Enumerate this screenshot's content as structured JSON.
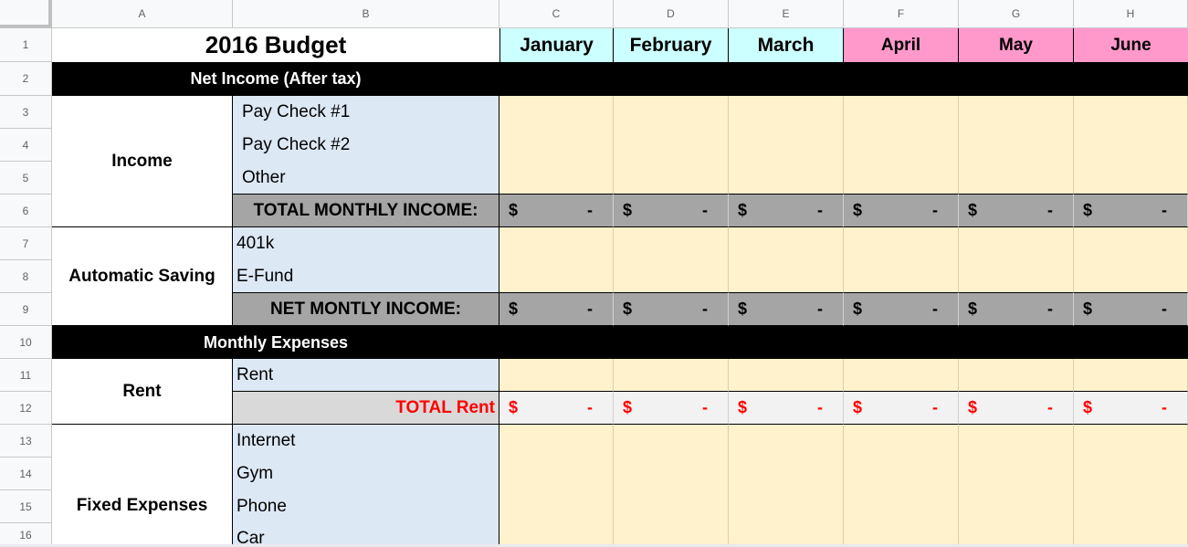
{
  "sheet": {
    "column_headers": [
      "A",
      "B",
      "C",
      "D",
      "E",
      "F",
      "G",
      "H"
    ],
    "row_headers": [
      "1",
      "2",
      "3",
      "4",
      "5",
      "6",
      "7",
      "8",
      "9",
      "10",
      "11",
      "12",
      "13",
      "14",
      "15",
      "16"
    ]
  },
  "budget": {
    "title": "2016 Budget",
    "months": [
      "January",
      "February",
      "March",
      "April",
      "May",
      "June"
    ],
    "colors": {
      "q1_month_bg": "#ccffff",
      "q2_month_bg": "#ff99cc",
      "input_bg": "#fff2cc",
      "label_bg": "#dde8f5",
      "total_bg": "#a5a5a5",
      "rent_total_text": "#ff0000"
    },
    "net_income_section": {
      "header": "Net Income (After tax)",
      "income": {
        "group": "Income",
        "items": [
          "Pay Check #1",
          "Pay Check #2",
          "Other"
        ],
        "total_label": "TOTAL MONTHLY INCOME:",
        "totals": [
          {
            "currency": "$",
            "value": "-"
          },
          {
            "currency": "$",
            "value": "-"
          },
          {
            "currency": "$",
            "value": "-"
          },
          {
            "currency": "$",
            "value": "-"
          },
          {
            "currency": "$",
            "value": "-"
          },
          {
            "currency": "$",
            "value": "-"
          }
        ]
      },
      "saving": {
        "group": "Automatic Saving",
        "items": [
          "401k",
          "E-Fund"
        ],
        "total_label": "NET MONTLY INCOME:",
        "totals": [
          {
            "currency": "$",
            "value": "-"
          },
          {
            "currency": "$",
            "value": "-"
          },
          {
            "currency": "$",
            "value": "-"
          },
          {
            "currency": "$",
            "value": "-"
          },
          {
            "currency": "$",
            "value": "-"
          },
          {
            "currency": "$",
            "value": "-"
          }
        ]
      }
    },
    "expenses_section": {
      "header": "Monthly Expenses",
      "rent": {
        "group": "Rent",
        "items": [
          "Rent"
        ],
        "total_label": "TOTAL Rent",
        "totals": [
          {
            "currency": "$",
            "value": "-"
          },
          {
            "currency": "$",
            "value": "-"
          },
          {
            "currency": "$",
            "value": "-"
          },
          {
            "currency": "$",
            "value": "-"
          },
          {
            "currency": "$",
            "value": "-"
          },
          {
            "currency": "$",
            "value": "-"
          }
        ]
      },
      "fixed": {
        "group": "Fixed Expenses",
        "items": [
          "Internet",
          "Gym",
          "Phone",
          "Car"
        ]
      }
    }
  }
}
